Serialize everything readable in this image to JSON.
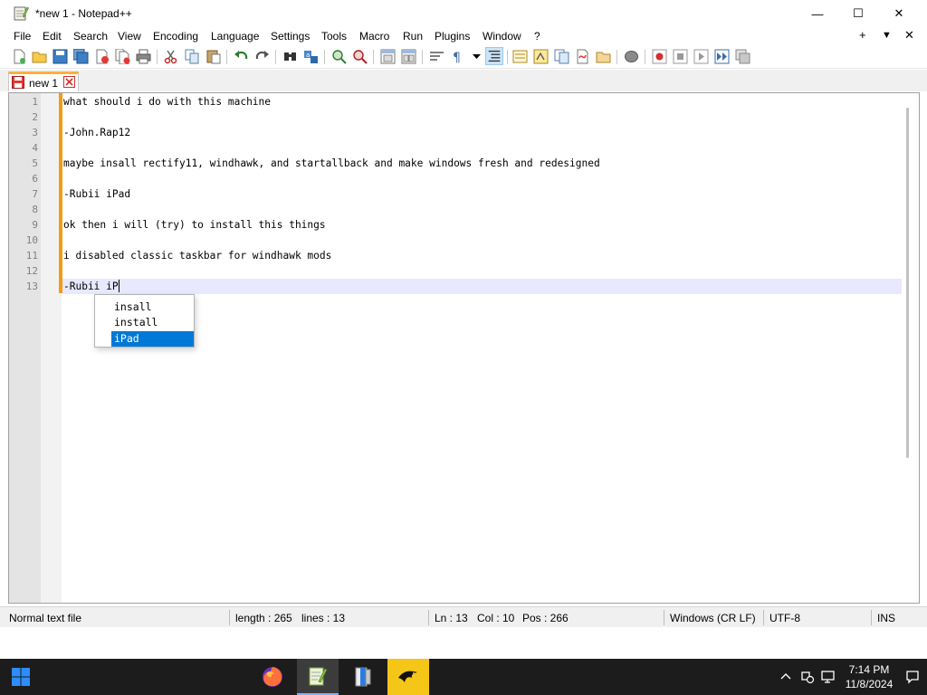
{
  "window": {
    "title": "*new 1 - Notepad++",
    "controls": {
      "minimize": "—",
      "maximize": "☐",
      "close": "✕"
    }
  },
  "menu": {
    "items": [
      "File",
      "Edit",
      "Search",
      "View",
      "Encoding",
      "Language",
      "Settings",
      "Tools",
      "Macro",
      "Run",
      "Plugins",
      "Window",
      "?"
    ],
    "right": [
      "+",
      "▼",
      "✕"
    ]
  },
  "toolbar": {
    "icons": [
      "new-file-icon",
      "open-file-icon",
      "save-icon",
      "save-all-icon",
      "close-icon",
      "close-all-icon",
      "print-icon",
      "cut-icon",
      "copy-icon",
      "paste-icon",
      "undo-icon",
      "redo-icon",
      "find-icon",
      "replace-icon",
      "zoom-in-icon",
      "zoom-out-icon",
      "sync-vertical-icon",
      "sync-horizontal-icon",
      "word-wrap-icon",
      "show-all-chars-icon",
      "indent-guide-icon",
      "function-list-icon",
      "doc-map-icon",
      "folder-workspace-icon",
      "doc-list-icon",
      "monitoring-icon",
      "record-macro-icon",
      "stop-macro-icon",
      "play-macro-icon",
      "run-macro-multiple-icon",
      "save-macro-icon"
    ]
  },
  "tab": {
    "label": "new 1"
  },
  "editor": {
    "lines": [
      "what should i do with this machine",
      "",
      "-John.Rap12",
      "",
      "maybe insall rectify11, windhawk, and startallback and make windows fresh and redesigned",
      "",
      "-Rubii iPad",
      "",
      "ok then i will (try) to install this things",
      "",
      "i disabled classic taskbar for windhawk mods",
      "",
      "-Rubii iP"
    ],
    "line_numbers": [
      "1",
      "2",
      "3",
      "4",
      "5",
      "6",
      "7",
      "8",
      "9",
      "10",
      "11",
      "12",
      "13"
    ]
  },
  "autocomplete": {
    "items": [
      "insall",
      "install",
      "iPad"
    ],
    "selected": "iPad"
  },
  "status": {
    "file_type": "Normal text file",
    "length": "length : 265",
    "lines": "lines : 13",
    "ln": "Ln : 13",
    "col": "Col : 10",
    "pos": "Pos : 266",
    "eol": "Windows (CR LF)",
    "encoding": "UTF-8",
    "mode": "INS"
  },
  "taskbar": {
    "apps": [
      "firefox-icon",
      "notepad-plus-plus-icon",
      "file-explorer-icon",
      "windhawk-icon"
    ],
    "time": "7:14 PM",
    "date": "11/8/2024"
  },
  "colors": {
    "accent": "#0078d7",
    "tab_top": "#fbb03b",
    "change_bar": "#f39c12",
    "current_line": "#e8e8ff",
    "taskbar": "#1c1c1c"
  }
}
